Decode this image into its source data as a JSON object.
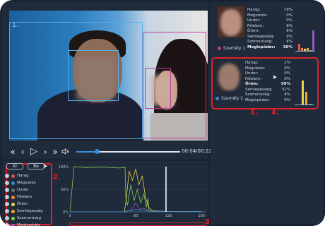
{
  "video": {
    "label": "1.",
    "time": "00:04/00:22",
    "progress": 0.2
  },
  "controls": {
    "prev_frame": "«",
    "back": "‹",
    "play": "▷",
    "forward": "›",
    "next_frame": "»",
    "volume": "🔈"
  },
  "legend": {
    "btn_all": "Ki",
    "btn_none": "Be",
    "items": [
      {
        "label": "Harag",
        "color": "#e0554b"
      },
      {
        "label": "Megvetés",
        "color": "#2e8fd6"
      },
      {
        "label": "Undor",
        "color": "#6e6e6e"
      },
      {
        "label": "Félelem",
        "color": "#f08a2a"
      },
      {
        "label": "Öröm",
        "color": "#e7d64a"
      },
      {
        "label": "Semlegesség",
        "color": "#f2a72e"
      },
      {
        "label": "Szomorúság",
        "color": "#7ed34b"
      },
      {
        "label": "Meglepődés",
        "color": "#9b59c6"
      }
    ]
  },
  "annotations": {
    "a1": "1.",
    "a2": "2.",
    "a3": "3.",
    "a4": "4."
  },
  "chart_data": {
    "type": "line",
    "y_ticks": [
      "100%",
      "50%",
      "0%"
    ],
    "x_ticks": [
      "0",
      "80",
      "120",
      "160"
    ],
    "ylim": [
      0,
      100
    ],
    "xlim": [
      0,
      165
    ],
    "series": [
      {
        "color": "#7ed34b",
        "x": [
          0,
          5,
          20,
          40,
          60,
          67,
          68,
          70,
          74,
          78,
          82,
          86,
          90,
          93,
          95,
          96,
          100,
          110,
          120,
          130,
          160
        ],
        "y": [
          0,
          100,
          98,
          99,
          97,
          98,
          30,
          15,
          60,
          25,
          50,
          20,
          40,
          10,
          30,
          2,
          1,
          1,
          1,
          1,
          1
        ]
      },
      {
        "color": "#e7d64a",
        "x": [
          0,
          60,
          66,
          68,
          72,
          76,
          80,
          84,
          88,
          92,
          96,
          100,
          120,
          160
        ],
        "y": [
          0,
          0,
          0,
          20,
          90,
          70,
          95,
          60,
          80,
          30,
          10,
          2,
          1,
          1
        ]
      },
      {
        "color": "#9b59c6",
        "x": [
          0,
          60,
          66,
          70,
          75,
          80,
          85,
          90,
          95,
          100,
          120,
          160
        ],
        "y": [
          0,
          0,
          0,
          2,
          5,
          20,
          5,
          8,
          3,
          1,
          1,
          1
        ]
      },
      {
        "color": "#2e8fd6",
        "x": [
          0,
          60,
          66,
          70,
          75,
          80,
          85,
          90,
          95,
          100,
          120,
          160
        ],
        "y": [
          0,
          0,
          0,
          3,
          2,
          6,
          3,
          4,
          2,
          1,
          1,
          1
        ]
      }
    ]
  },
  "persons": [
    {
      "name": "Személy 1",
      "color": "#c03ea3",
      "emotions": [
        {
          "label": "Harag:",
          "value": "19%"
        },
        {
          "label": "Megvetés:",
          "value": "0%"
        },
        {
          "label": "Undor:",
          "value": "0%"
        },
        {
          "label": "Félelem:",
          "value": "9%"
        },
        {
          "label": "Öröm:",
          "value": "6%"
        },
        {
          "label": "Semlegesség:",
          "value": "9%"
        },
        {
          "label": "Szomorúság:",
          "value": "4%"
        },
        {
          "label": "Meglepődés:",
          "value": "50%",
          "bold": true
        }
      ],
      "bars": [
        {
          "color": "#e0554b",
          "value": 0.19
        },
        {
          "color": "#f08a2a",
          "value": 0.09
        },
        {
          "color": "#e7d64a",
          "value": 0.06
        },
        {
          "color": "#f2a72e",
          "value": 0.09
        },
        {
          "color": "#7ed34b",
          "value": 0.04
        },
        {
          "color": "#9b59c6",
          "value": 0.5
        }
      ]
    },
    {
      "name": "Személy 2",
      "color": "#2e8fd6",
      "emotions": [
        {
          "label": "Harag:",
          "value": "2%"
        },
        {
          "label": "Megvetés:",
          "value": "0%"
        },
        {
          "label": "Undor:",
          "value": "0%"
        },
        {
          "label": "Félelem:",
          "value": "0%"
        },
        {
          "label": "Öröm:",
          "value": "59%",
          "bold": true
        },
        {
          "label": "Semlegesség:",
          "value": "31%"
        },
        {
          "label": "Szomorúság:",
          "value": "4%"
        },
        {
          "label": "Meglepődés:",
          "value": "0%"
        }
      ],
      "bars": [
        {
          "color": "#e0554b",
          "value": 0.02
        },
        {
          "color": "#e7d64a",
          "value": 0.59
        },
        {
          "color": "#f2a72e",
          "value": 0.31
        },
        {
          "color": "#7ed34b",
          "value": 0.04
        }
      ]
    }
  ]
}
